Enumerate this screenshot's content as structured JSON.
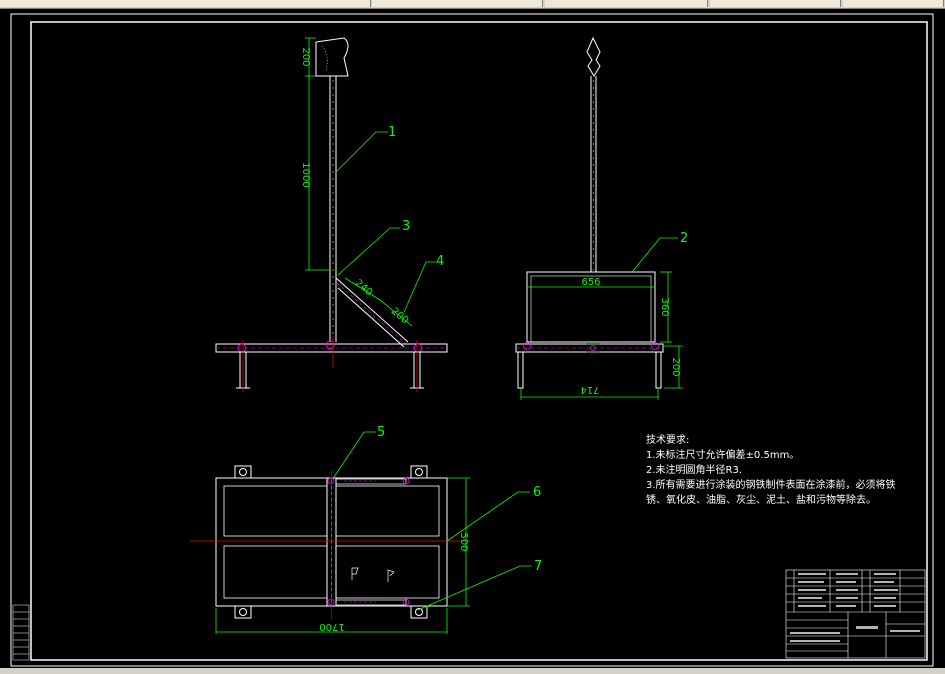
{
  "notes": {
    "title": "技术要求:",
    "line1": "1.未标注尺寸允许偏差±0.5mm。",
    "line2": "2.未注明圆角半径R3.",
    "line3": "3.所有需要进行涂装的钢铁制件表面在涂漆前，必须将铁锈、氧化皮、油脂、灰尘、泥土、盐和污物等除去。"
  },
  "balloons": [
    "1",
    "2",
    "3",
    "4",
    "5",
    "6",
    "7"
  ],
  "dims": {
    "d200a": "200",
    "d1000": "1000",
    "d240": "240",
    "d200b": "200",
    "d656": "656",
    "d360": "360",
    "d200c": "200",
    "d714": "714",
    "d500": "500",
    "d1700": "1700"
  },
  "colors": {
    "frame": "#ffffff",
    "part": "#ffffff",
    "dimension": "#00ff00",
    "center": "#ff0000",
    "hidden": "#ff00ff"
  }
}
